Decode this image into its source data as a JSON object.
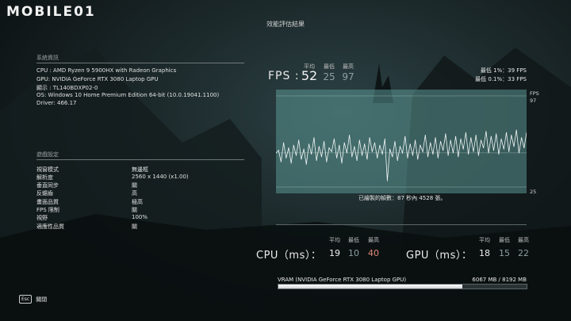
{
  "header": {
    "logo_text": "MOBILE01",
    "title": "效能評估結果"
  },
  "system": {
    "heading": "系統資訊",
    "lines": [
      "CPU : AMD Ryzen 9 5900HX with Radeon Graphics",
      "GPU: NVIDIA GeForce RTX 3080 Laptop GPU",
      "顯示 : TL140BDXP02-0",
      "OS: Windows 10 Home Premium Edition 64-bit (10.0.19041.1100)",
      "Driver: 466.17"
    ]
  },
  "settings": {
    "heading": "遊戲設定",
    "items": [
      {
        "label": "視窗模式",
        "value": "無邊框"
      },
      {
        "label": "解析度",
        "value": "2560 x 1440 (x1.00)"
      },
      {
        "label": "垂直同步",
        "value": "關"
      },
      {
        "label": "反鋸齒",
        "value": "高"
      },
      {
        "label": "畫面品質",
        "value": "極高"
      },
      {
        "label": "FPS 限制",
        "value": "關"
      },
      {
        "label": "視野",
        "value": "100%"
      },
      {
        "label": "適應性品質",
        "value": "關"
      }
    ]
  },
  "fps": {
    "label": "FPS :",
    "avg_label": "平均",
    "min_label": "最低",
    "max_label": "最高",
    "avg": "52",
    "min": "25",
    "max": "97",
    "low1_text": "最低 1%：39 FPS",
    "low01_text": "最低 0.1%：33 FPS"
  },
  "graph": {
    "unit": "FPS",
    "y_top": "97",
    "y_bottom": "25",
    "frames_note": "已繪製的幀數：87 秒內 4528 張。"
  },
  "chart_data": {
    "type": "line",
    "ylabel": "FPS",
    "ylim": [
      25,
      97
    ],
    "series": [
      {
        "values": [
          52,
          54,
          45,
          60,
          48,
          56,
          44,
          58,
          50,
          62,
          47,
          55,
          43,
          59,
          51,
          64,
          46,
          57,
          49,
          61,
          45,
          56,
          53,
          63,
          48,
          58,
          44,
          60,
          52,
          66,
          49,
          57,
          46,
          62,
          50,
          59,
          47,
          64,
          53,
          60,
          48,
          58,
          51,
          63,
          30,
          55,
          49,
          61,
          46,
          57,
          52,
          65,
          48,
          59,
          50,
          62,
          47,
          58,
          53,
          66,
          49,
          60,
          51,
          64,
          48,
          61,
          54,
          67,
          50,
          62,
          52,
          65,
          49,
          63,
          55,
          68,
          51,
          64,
          53,
          66,
          50,
          62,
          56,
          69,
          52,
          65,
          54,
          67,
          51,
          63,
          55,
          68,
          53,
          66,
          57,
          70,
          52,
          64,
          56,
          68
        ]
      }
    ]
  },
  "cpu": {
    "label": "CPU（ms）：",
    "avg_label": "平均",
    "min_label": "最低",
    "max_label": "最高",
    "avg": "19",
    "min": "10",
    "max": "40"
  },
  "gpu": {
    "label": "GPU（ms）：",
    "avg_label": "平均",
    "min_label": "最低",
    "max_label": "最高",
    "avg": "18",
    "min": "15",
    "max": "22"
  },
  "vram": {
    "label": "VRAM (NVIDIA GeForce RTX 3080 Laptop GPU)",
    "value": "6067 MB / 8192 MB",
    "used_fraction": 0.741
  },
  "footer": {
    "esc_key": "Esc",
    "esc_label": "關閉"
  },
  "colors": {
    "max_highlight": "#e08a7a",
    "muted": "#8f9fa1",
    "graph_bg": "#4e8f8a"
  }
}
